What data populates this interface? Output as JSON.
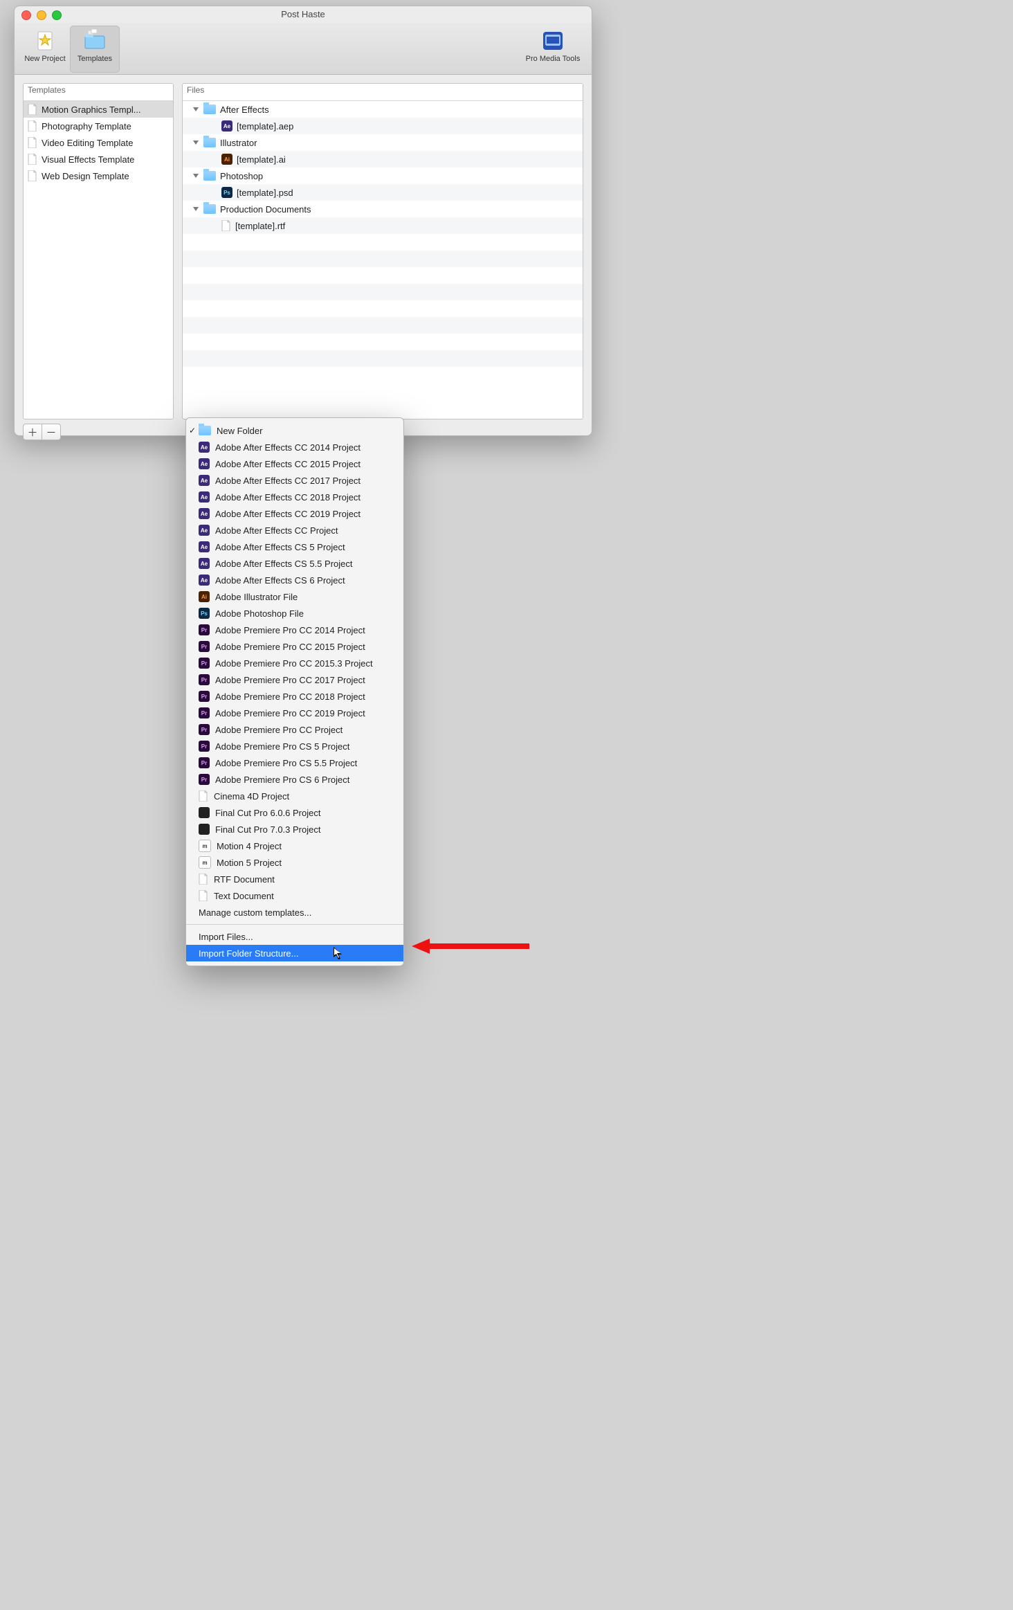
{
  "window_title": "Post Haste",
  "toolbar": {
    "new_project": "New Project",
    "templates": "Templates",
    "pro_media": "Pro Media Tools"
  },
  "panels": {
    "templates_header": "Templates",
    "files_header": "Files"
  },
  "templates": [
    {
      "label": "Motion Graphics Templ...",
      "selected": true
    },
    {
      "label": "Photography Template"
    },
    {
      "label": "Video Editing Template"
    },
    {
      "label": "Visual Effects Template"
    },
    {
      "label": "Web Design Template"
    }
  ],
  "files": [
    {
      "type": "folder",
      "indent": 0,
      "label": "After Effects",
      "alt": false
    },
    {
      "type": "file",
      "indent": 1,
      "label": "[template].aep",
      "icon": "ae",
      "alt": true
    },
    {
      "type": "folder",
      "indent": 0,
      "label": "Illustrator",
      "alt": false
    },
    {
      "type": "file",
      "indent": 1,
      "label": "[template].ai",
      "icon": "ai",
      "alt": true
    },
    {
      "type": "folder",
      "indent": 0,
      "label": "Photoshop",
      "alt": false
    },
    {
      "type": "file",
      "indent": 1,
      "label": "[template].psd",
      "icon": "ps",
      "alt": true
    },
    {
      "type": "folder",
      "indent": 0,
      "label": "Production Documents",
      "alt": false
    },
    {
      "type": "file",
      "indent": 1,
      "label": "[template].rtf",
      "icon": "doc",
      "alt": true
    }
  ],
  "menu": {
    "items": [
      {
        "label": "New Folder",
        "icon": "fold",
        "checked": true
      },
      {
        "label": "Adobe After Effects CC 2014 Project",
        "icon": "ae"
      },
      {
        "label": "Adobe After Effects CC 2015 Project",
        "icon": "ae"
      },
      {
        "label": "Adobe After Effects CC 2017 Project",
        "icon": "ae"
      },
      {
        "label": "Adobe After Effects CC 2018 Project",
        "icon": "ae"
      },
      {
        "label": "Adobe After Effects CC 2019 Project",
        "icon": "ae"
      },
      {
        "label": "Adobe After Effects CC Project",
        "icon": "ae"
      },
      {
        "label": "Adobe After Effects CS 5 Project",
        "icon": "ae"
      },
      {
        "label": "Adobe After Effects CS 5.5 Project",
        "icon": "ae"
      },
      {
        "label": "Adobe After Effects CS 6 Project",
        "icon": "ae"
      },
      {
        "label": "Adobe Illustrator File",
        "icon": "ai"
      },
      {
        "label": "Adobe Photoshop File",
        "icon": "ps"
      },
      {
        "label": "Adobe Premiere Pro CC 2014 Project",
        "icon": "pr"
      },
      {
        "label": "Adobe Premiere Pro CC 2015 Project",
        "icon": "pr"
      },
      {
        "label": "Adobe Premiere Pro CC 2015.3 Project",
        "icon": "pr"
      },
      {
        "label": "Adobe Premiere Pro CC 2017 Project",
        "icon": "pr"
      },
      {
        "label": "Adobe Premiere Pro CC 2018 Project",
        "icon": "pr"
      },
      {
        "label": "Adobe Premiere Pro CC 2019 Project",
        "icon": "pr"
      },
      {
        "label": "Adobe Premiere Pro CC Project",
        "icon": "pr"
      },
      {
        "label": "Adobe Premiere Pro CS 5 Project",
        "icon": "pr"
      },
      {
        "label": "Adobe Premiere Pro CS 5.5 Project",
        "icon": "pr"
      },
      {
        "label": "Adobe Premiere Pro CS 6 Project",
        "icon": "pr"
      },
      {
        "label": "Cinema 4D Project",
        "icon": "doc"
      },
      {
        "label": "Final Cut Pro 6.0.6 Project",
        "icon": "blk"
      },
      {
        "label": "Final Cut Pro 7.0.3 Project",
        "icon": "blk"
      },
      {
        "label": "Motion 4 Project",
        "icon": "mo"
      },
      {
        "label": "Motion 5 Project",
        "icon": "mo"
      },
      {
        "label": "RTF Document",
        "icon": "doc"
      },
      {
        "label": "Text Document",
        "icon": "doc"
      }
    ],
    "manage": "Manage custom templates...",
    "import_files": "Import Files...",
    "import_folder": "Import Folder Structure..."
  }
}
